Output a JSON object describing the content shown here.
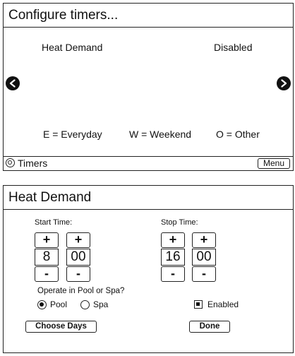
{
  "configure_screen": {
    "title": "Configure timers...",
    "timer_name": "Heat Demand",
    "timer_state": "Disabled",
    "legend": {
      "everyday": "E = Everyday",
      "weekend": "W = Weekend",
      "other": "O = Other"
    },
    "status_label": "Timers",
    "menu_button": "Menu"
  },
  "heat_demand_screen": {
    "title": "Heat Demand",
    "start_label": "Start Time:",
    "stop_label": "Stop Time:",
    "plus": "+",
    "minus": "-",
    "start_hour": "8",
    "start_minute": "00",
    "stop_hour": "16",
    "stop_minute": "00",
    "mode_question": "Operate in Pool or Spa?",
    "pool_label": "Pool",
    "spa_label": "Spa",
    "selected_mode": "Pool",
    "enabled_label": "Enabled",
    "enabled_checked": true,
    "choose_days_button": "Choose Days",
    "done_button": "Done"
  }
}
